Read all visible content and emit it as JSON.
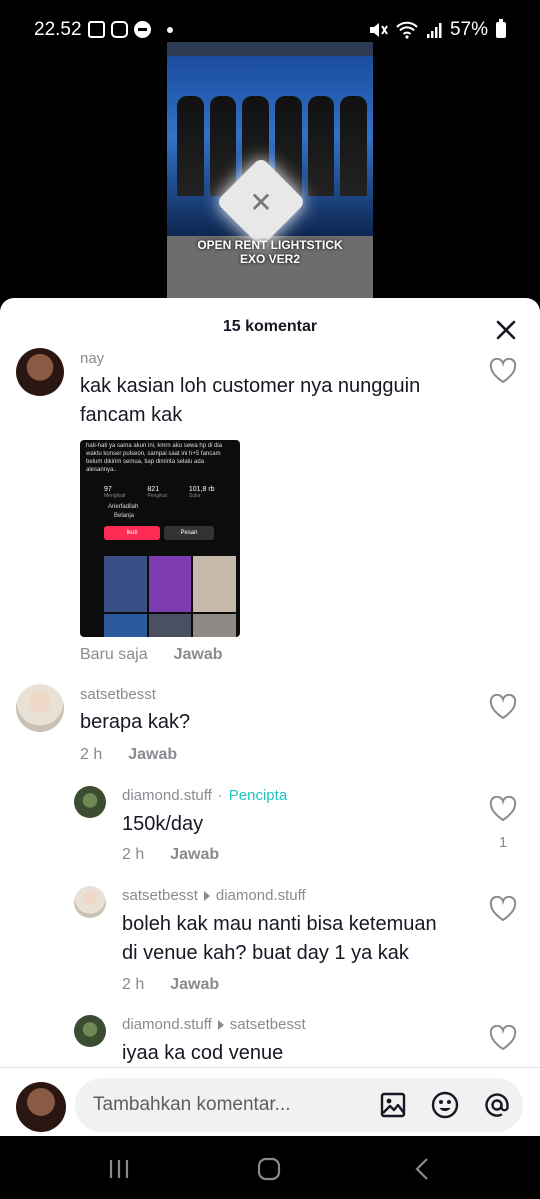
{
  "status_bar": {
    "time": "22.52",
    "battery": "57%"
  },
  "video": {
    "caption_line1": "OPEN RENT LIGHTSTICK",
    "caption_line2": "EXO VER2"
  },
  "sheet": {
    "title": "15 komentar"
  },
  "comments": [
    {
      "username": "nay",
      "text_line1": "kak kasian loh customer nya nungguin",
      "text_line2": "fancam kak",
      "time": "Baru saja",
      "reply_label": "Jawab",
      "attachment": {
        "caption": "hati-hati ya sama akun ini, kmrn aku sewa hp di dia waktu konser pulseon, sampai saat ini h+5 fancam belum dikirim semua, tiap diminta selalu ada alesannya..",
        "stats": [
          "97",
          "821",
          "101,8 rb"
        ],
        "stat_labels": [
          "Mengikuti",
          "Pengikut",
          "Suka"
        ],
        "account": "Arierfadilah",
        "shop": "Belanja",
        "follow_label": "Ikuti",
        "message_label": "Pesan"
      }
    },
    {
      "username": "satsetbesst",
      "text": "berapa kak?",
      "time": "2 h",
      "reply_label": "Jawab"
    }
  ],
  "replies": [
    {
      "username": "diamond.stuff",
      "creator_tag": "Pencipta",
      "text": "150k/day",
      "time": "2 h",
      "reply_label": "Jawab",
      "likes": "1"
    },
    {
      "username": "satsetbesst",
      "reply_to": "diamond.stuff",
      "text_line1": "boleh kak mau nanti bisa ketemuan",
      "text_line2": "di venue kah? buat day 1 ya kak",
      "time": "2 h",
      "reply_label": "Jawab"
    },
    {
      "username": "diamond.stuff",
      "reply_to": "satsetbesst",
      "text": "iyaa ka cod venue"
    }
  ],
  "input": {
    "placeholder": "Tambahkan komentar..."
  },
  "icons": {
    "close": "close-icon",
    "heart": "heart-icon",
    "image": "image-icon",
    "emoji": "emoji-icon",
    "mention": "mention-icon"
  }
}
